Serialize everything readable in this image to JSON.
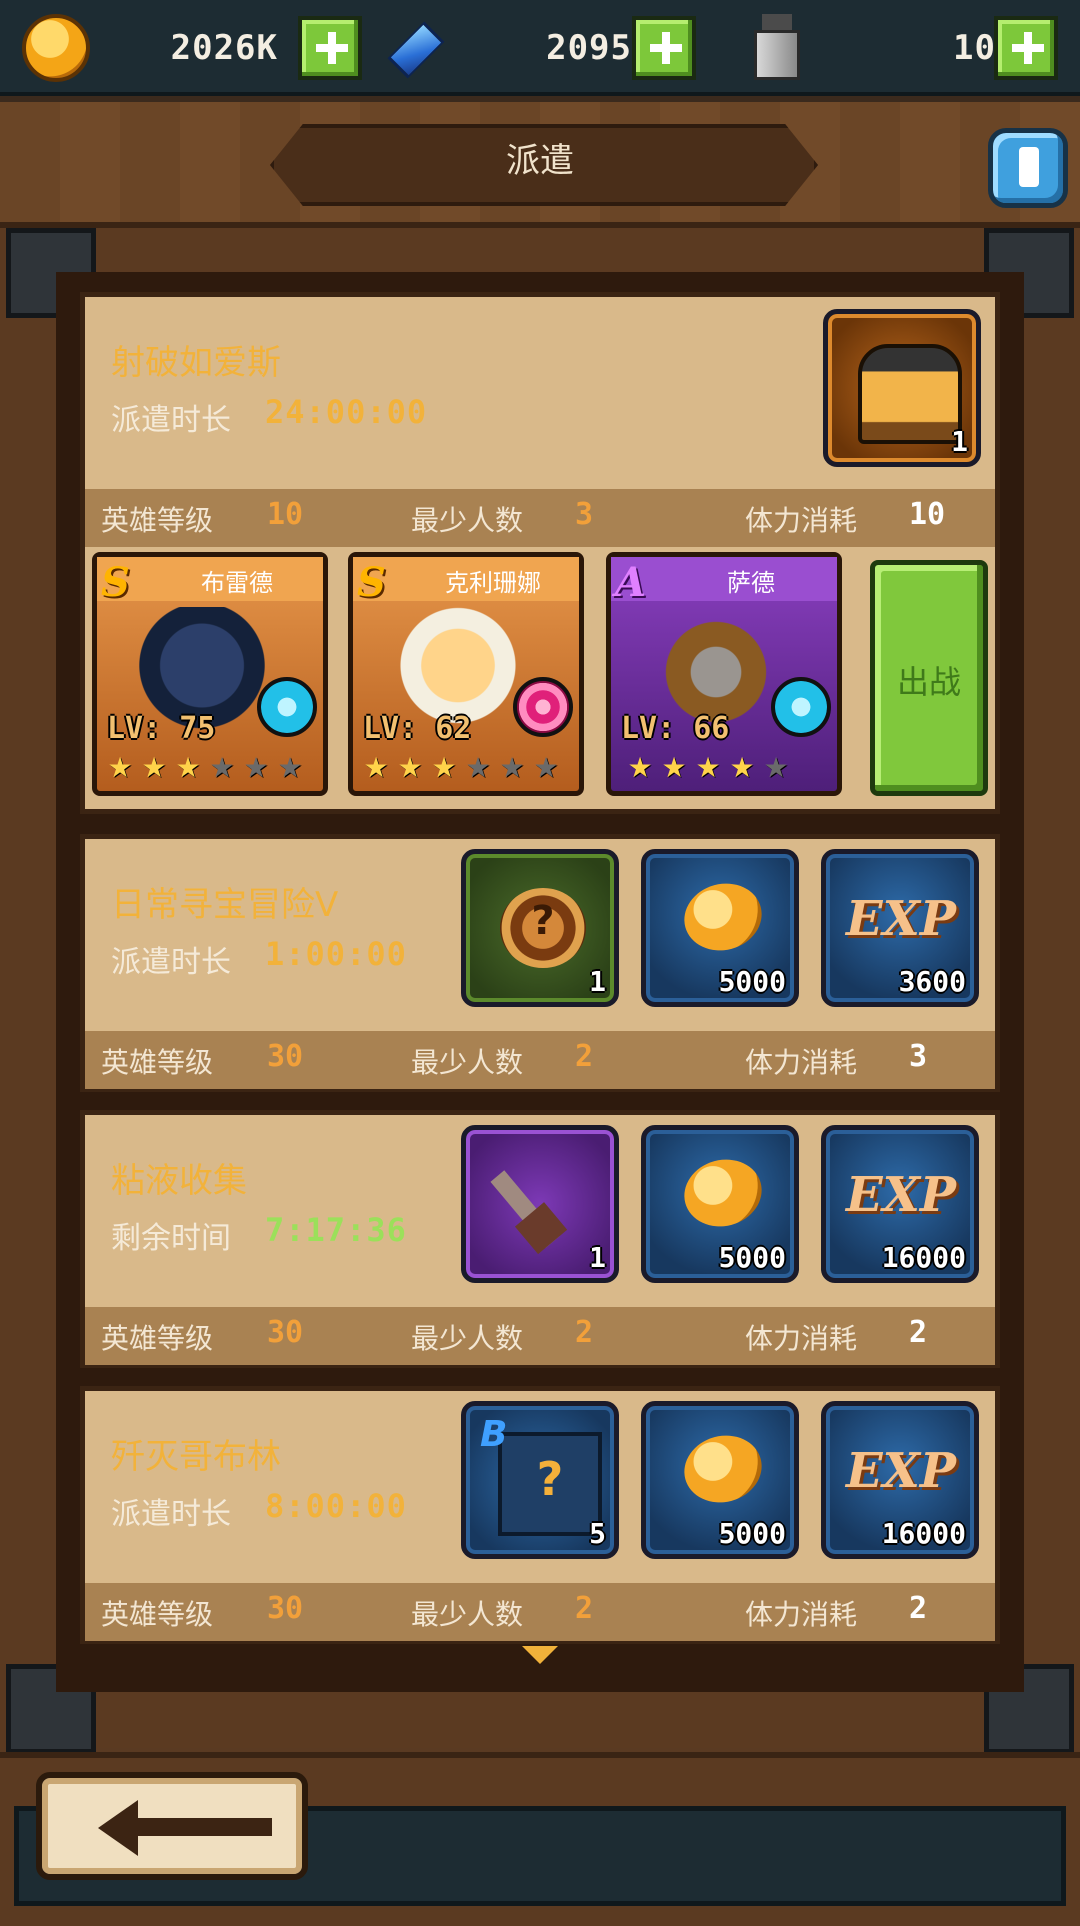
{
  "resources": {
    "gold": "2026K",
    "gems": "2095",
    "stamina": "10"
  },
  "title": "派遣",
  "missions": [
    {
      "name": "射破如爱斯",
      "time_label": "派遣时长",
      "time_value": "24:00:00",
      "hero_level_label": "英雄等级",
      "hero_level": "10",
      "min_people_label": "最少人数",
      "min_people": "3",
      "stamina_label": "体力消耗",
      "stamina": "10",
      "rewards": [
        {
          "icon": "helmet-icon",
          "count": "1"
        }
      ]
    },
    {
      "name": "日常寻宝冒险V",
      "time_label": "派遣时长",
      "time_value": "1:00:00",
      "hero_level_label": "英雄等级",
      "hero_level": "30",
      "min_people_label": "最少人数",
      "min_people": "2",
      "stamina_label": "体力消耗",
      "stamina": "3",
      "rewards": [
        {
          "icon": "mystery-chest-icon",
          "count": "1"
        },
        {
          "icon": "gold-coin-icon",
          "count": "5000"
        },
        {
          "icon": "exp-icon",
          "count": "3600"
        }
      ]
    },
    {
      "name": "粘液收集",
      "time_label": "剩余时间",
      "time_value": "7:17:36",
      "hero_level_label": "英雄等级",
      "hero_level": "30",
      "min_people_label": "最少人数",
      "min_people": "2",
      "stamina_label": "体力消耗",
      "stamina": "2",
      "rewards": [
        {
          "icon": "sword-icon",
          "count": "1"
        },
        {
          "icon": "gold-coin-icon",
          "count": "5000"
        },
        {
          "icon": "exp-icon",
          "count": "16000"
        }
      ]
    },
    {
      "name": "歼灭哥布林",
      "time_label": "派遣时长",
      "time_value": "8:00:00",
      "hero_level_label": "英雄等级",
      "hero_level": "30",
      "min_people_label": "最少人数",
      "min_people": "2",
      "stamina_label": "体力消耗",
      "stamina": "2",
      "rewards": [
        {
          "icon": "mystery-box-icon",
          "count": "5"
        },
        {
          "icon": "gold-coin-icon",
          "count": "5000"
        },
        {
          "icon": "exp-icon",
          "count": "16000"
        }
      ]
    }
  ],
  "heroes": [
    {
      "name": "布雷德",
      "rank": "S",
      "level": "LV: 75",
      "stars": 3
    },
    {
      "name": "克利珊娜",
      "rank": "S",
      "level": "LV: 62",
      "stars": 3
    },
    {
      "name": "萨德",
      "rank": "A",
      "level": "LV: 66",
      "stars": 4
    }
  ],
  "go_button": "出战",
  "exp_text": "EXP",
  "colors": {
    "accent_orange": "#f2b23a",
    "green_timer": "#9be05a",
    "card_bg": "#d9b98a"
  }
}
